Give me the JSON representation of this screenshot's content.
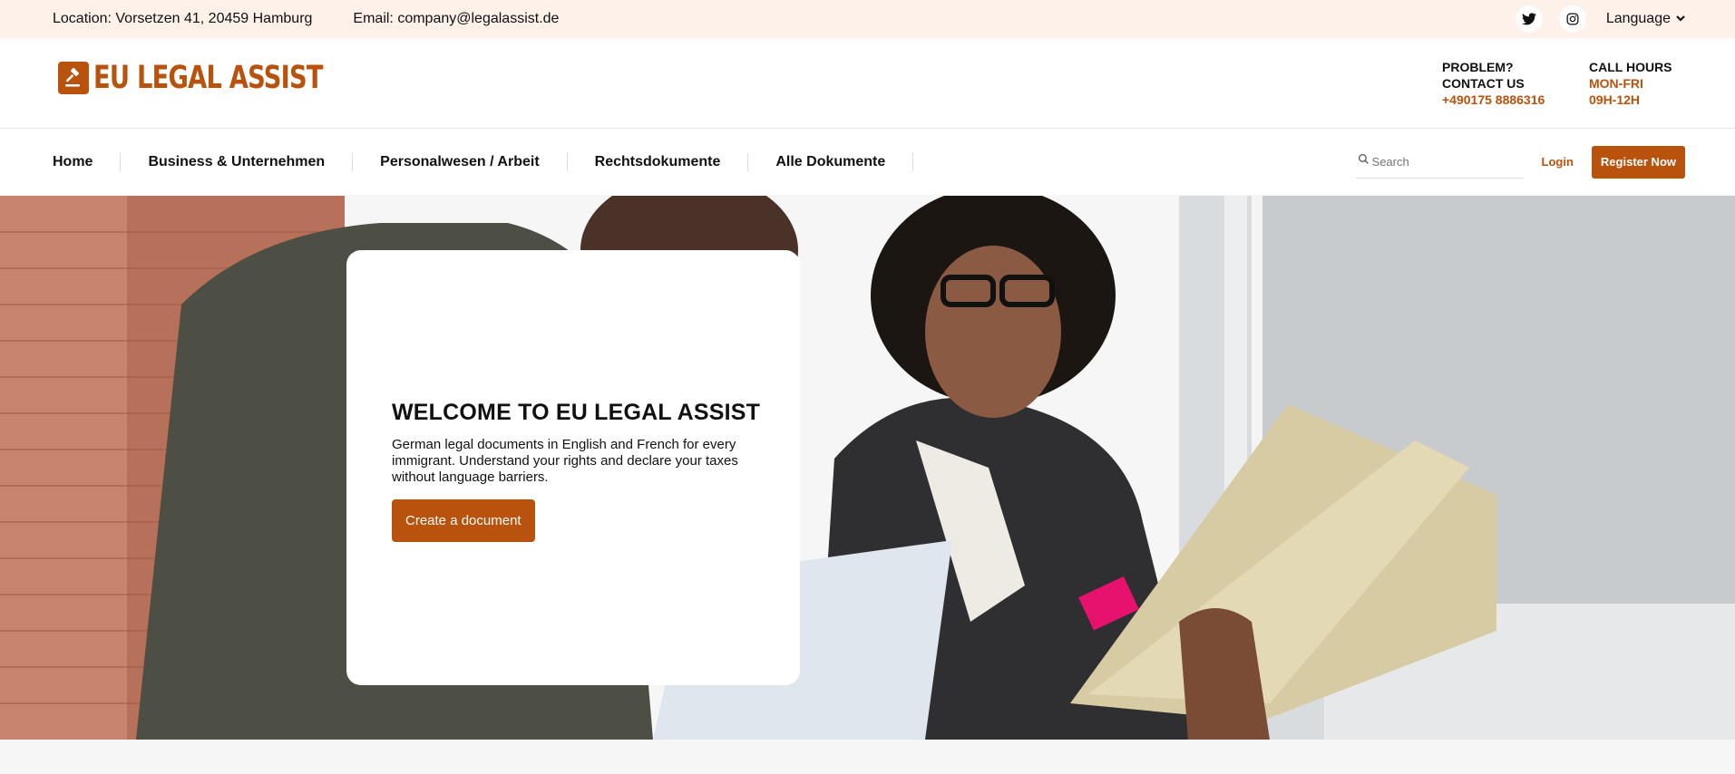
{
  "topbar": {
    "location": "Location: Vorsetzen 41, 20459 Hamburg",
    "email": "Email: company@legalassist.de",
    "social": [
      "twitter-icon",
      "instagram-icon"
    ],
    "language": "Language"
  },
  "header": {
    "logo_text": "EU LEGAL ASSIST",
    "problem_line1": "PROBLEM?",
    "problem_line2": "CONTACT US",
    "phone": "+490175 8886316",
    "hours_title": "CALL HOURS",
    "hours_days": "MON-FRI",
    "hours_time": "09H-12H"
  },
  "nav": {
    "items": [
      "Home",
      "Business & Unternehmen",
      "Personalwesen / Arbeit",
      "Rechtsdokumente",
      "Alle Dokumente"
    ],
    "search_placeholder": "Search",
    "login": "Login",
    "register": "Register Now"
  },
  "hero": {
    "title": "WELCOME TO EU LEGAL ASSIST",
    "description": "German legal documents in English and French for every immigrant. Understand your rights and declare your taxes without language barriers.",
    "cta": "Create a document"
  },
  "colors": {
    "accent": "#b8520c",
    "topbar_bg": "#fdf1ea"
  }
}
